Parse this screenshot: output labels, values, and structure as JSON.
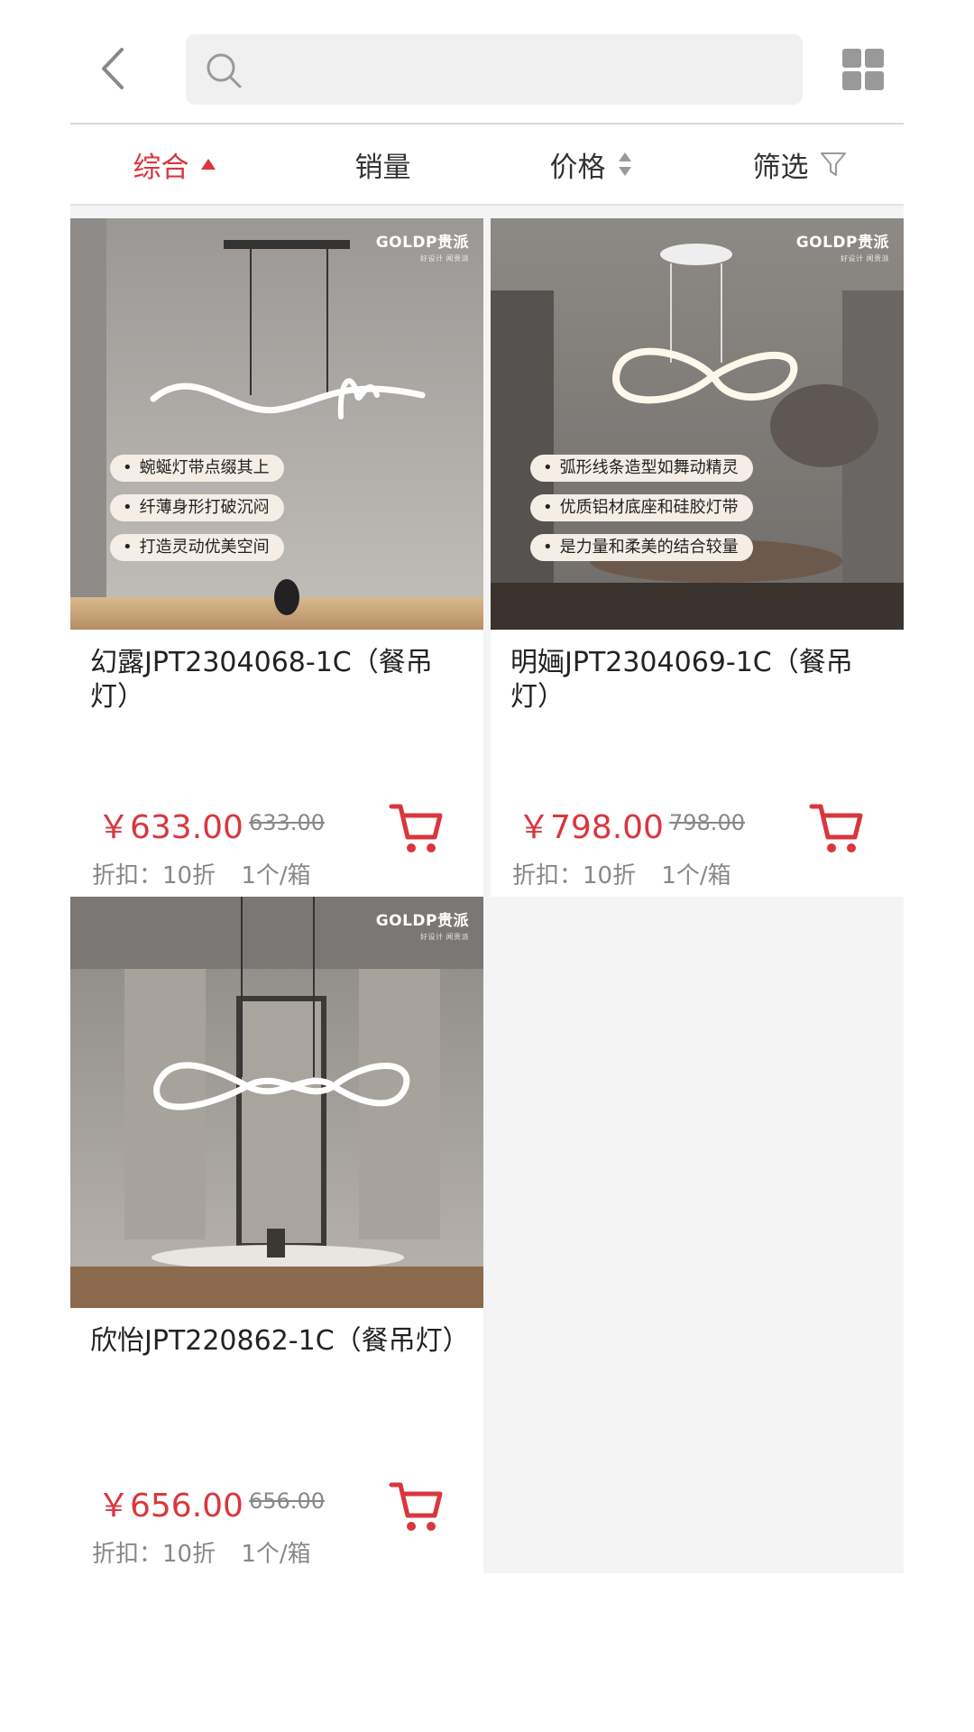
{
  "search": {
    "value": "",
    "placeholder": ""
  },
  "sortbar": {
    "items": [
      {
        "label": "综合",
        "active": true
      },
      {
        "label": "销量"
      },
      {
        "label": "价格"
      },
      {
        "label": "筛选"
      }
    ]
  },
  "products": [
    {
      "brand": "GOLDP贵派",
      "brand_sub": "好设计 闻贵派",
      "features": [
        "蜿蜒灯带点缀其上",
        "纤薄身形打破沉闷",
        "打造灵动优美空间"
      ],
      "name": "幻露JPT2304068-1C（餐吊灯）",
      "price": "￥633.00",
      "original_price": "633.00",
      "discount_text": "折扣：10折",
      "unit_text": "1个/箱"
    },
    {
      "brand": "GOLDP贵派",
      "brand_sub": "好设计 闻贵派",
      "features": [
        "弧形线条造型如舞动精灵",
        "优质铝材底座和硅胶灯带",
        "是力量和柔美的结合较量"
      ],
      "name": "明婳JPT2304069-1C（餐吊灯）",
      "price": "￥798.00",
      "original_price": "798.00",
      "discount_text": "折扣：10折",
      "unit_text": "1个/箱"
    },
    {
      "brand": "GOLDP贵派",
      "brand_sub": "好设计 闻贵派",
      "features": [],
      "name": "欣怡JPT220862-1C（餐吊灯）",
      "price": "￥656.00",
      "original_price": "656.00",
      "discount_text": "折扣：10折",
      "unit_text": "1个/箱"
    }
  ],
  "colors": {
    "accent": "#d9363e",
    "muted": "#888888",
    "background": "#f4f4f4"
  }
}
